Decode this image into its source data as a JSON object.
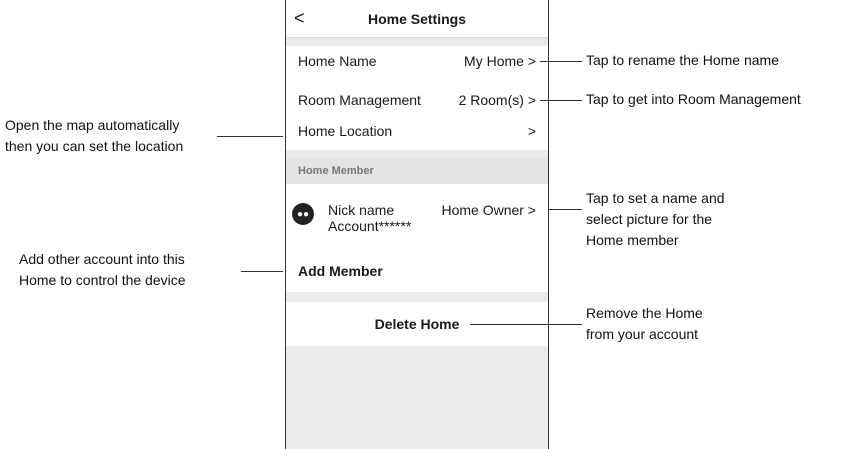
{
  "header": {
    "back": "<",
    "title": "Home Settings"
  },
  "rows": {
    "home_name": {
      "label": "Home Name",
      "value": "My Home >"
    },
    "room_mgmt": {
      "label": "Room Management",
      "value": "2 Room(s) >"
    },
    "home_location": {
      "label": "Home Location",
      "value": ">"
    }
  },
  "member_section": {
    "title": "Home Member",
    "member": {
      "name": "Nick name",
      "account": "Account******",
      "role": "Home Owner >"
    },
    "add": "Add Member"
  },
  "delete": "Delete Home",
  "annotations": {
    "rename": "Tap to rename the Home name",
    "room": "Tap to get into Room Management",
    "map_1": "Open the map automatically",
    "map_2": "then you can set the location",
    "member_1": "Tap to set a name and",
    "member_2": "select picture for the",
    "member_3": "Home member",
    "add_1": "Add other account into this",
    "add_2": "Home to control the device",
    "remove_1": "Remove the Home",
    "remove_2": "from your account"
  }
}
